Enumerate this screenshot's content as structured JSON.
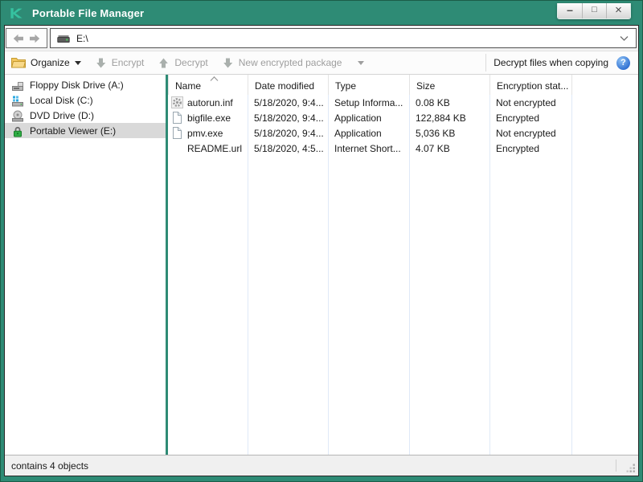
{
  "window": {
    "title": "Portable File Manager",
    "controls": {
      "minimize": "–",
      "maximize": "□",
      "close": "×"
    }
  },
  "navbar": {
    "address_value": "E:\\"
  },
  "toolbar": {
    "organize_label": "Organize",
    "encrypt_label": "Encrypt",
    "decrypt_label": "Decrypt",
    "new_package_label": "New encrypted package",
    "decrypt_copy_label": "Decrypt files when copying",
    "help_glyph": "?"
  },
  "sidebar": {
    "items": [
      {
        "label": "Floppy Disk Drive (A:)",
        "icon": "floppy-drive-icon",
        "selected": false
      },
      {
        "label": "Local Disk (C:)",
        "icon": "local-disk-icon",
        "selected": false
      },
      {
        "label": "DVD Drive (D:)",
        "icon": "dvd-drive-icon",
        "selected": false
      },
      {
        "label": "Portable Viewer (E:)",
        "icon": "padlock-icon",
        "selected": true
      }
    ]
  },
  "filelist": {
    "columns": [
      "Name",
      "Date modified",
      "Type",
      "Size",
      "Encryption stat..."
    ],
    "sort": {
      "column": "Name",
      "direction": "ascending"
    },
    "rows": [
      {
        "name": "autorun.inf",
        "date": "5/18/2020, 9:4...",
        "type": "Setup Informa...",
        "size": "0.08 KB",
        "status": "Not encrypted",
        "icon": "setup-file-icon"
      },
      {
        "name": "bigfile.exe",
        "date": "5/18/2020, 9:4...",
        "type": "Application",
        "size": "122,884 KB",
        "status": "Encrypted",
        "icon": "file-icon"
      },
      {
        "name": "pmv.exe",
        "date": "5/18/2020, 9:4...",
        "type": "Application",
        "size": "5,036 KB",
        "status": "Not encrypted",
        "icon": "file-icon"
      },
      {
        "name": "README.url",
        "date": "5/18/2020, 4:5...",
        "type": "Internet Short...",
        "size": "4.07 KB",
        "status": "Encrypted",
        "icon": "none"
      }
    ]
  },
  "statusbar": {
    "text": "contains 4 objects"
  },
  "colors": {
    "brand_teal": "#2E8B75",
    "logo_teal": "#36C2A0",
    "selection_gray": "#D9D9D9",
    "column_line_blue": "#DFE9F7",
    "disabled_text": "#9E9E9E",
    "help_blue": "#3D7EDB",
    "lock_green": "#2FAE45",
    "folder_yellow": "#F3C75F"
  }
}
